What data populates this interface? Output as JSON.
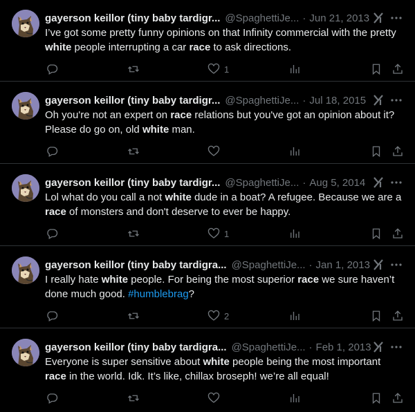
{
  "colors": {
    "background": "#000000",
    "text": "#e7e9ea",
    "muted": "#71767b",
    "hashtag": "#1d9bf0",
    "avatar_bg": "#8a86b8"
  },
  "tweets": [
    {
      "display_name": "gayerson keillor (tiny baby tardigr...",
      "handle": "@SpaghettiJe...",
      "sep": "·",
      "date": "Jun 21, 2013",
      "segments": [
        {
          "t": "I’ve got some pretty funny opinions on that Infinity commercial with the pretty "
        },
        {
          "t": "white",
          "b": true
        },
        {
          "t": " people interrupting a car "
        },
        {
          "t": "race",
          "b": true
        },
        {
          "t": " to ask directions."
        }
      ],
      "likes": "1"
    },
    {
      "display_name": "gayerson keillor (tiny baby tardigr...",
      "handle": "@SpaghettiJe...",
      "sep": "·",
      "date": "Jul 18, 2015",
      "segments": [
        {
          "t": "Oh you're not an expert on "
        },
        {
          "t": "race",
          "b": true
        },
        {
          "t": " relations but you've got an opinion about it? Please do go on, old "
        },
        {
          "t": "white",
          "b": true
        },
        {
          "t": " man."
        }
      ],
      "likes": ""
    },
    {
      "display_name": "gayerson keillor (tiny baby tardigr...",
      "handle": "@SpaghettiJe...",
      "sep": "·",
      "date": "Aug 5, 2014",
      "segments": [
        {
          "t": "Lol what do you call a not "
        },
        {
          "t": "white",
          "b": true
        },
        {
          "t": " dude in a boat? A refugee. Because we are a "
        },
        {
          "t": "race",
          "b": true
        },
        {
          "t": " of monsters and don't deserve to ever be happy."
        }
      ],
      "likes": "1"
    },
    {
      "display_name": "gayerson keillor (tiny baby tardigra...",
      "handle": "@SpaghettiJe...",
      "sep": "·",
      "date": "Jan 1, 2013",
      "segments": [
        {
          "t": "I really hate "
        },
        {
          "t": "white",
          "b": true
        },
        {
          "t": " people. For being the most superior "
        },
        {
          "t": "race",
          "b": true
        },
        {
          "t": " we sure haven’t done much good. "
        },
        {
          "t": "#humblebrag",
          "tag": true
        },
        {
          "t": "?"
        }
      ],
      "likes": "2"
    },
    {
      "display_name": "gayerson keillor (tiny baby tardigra...",
      "handle": "@SpaghettiJe...",
      "sep": "·",
      "date": "Feb 1, 2013",
      "segments": [
        {
          "t": "Everyone is super sensitive about "
        },
        {
          "t": "white",
          "b": true
        },
        {
          "t": " people being the most important "
        },
        {
          "t": "race",
          "b": true
        },
        {
          "t": " in the world. Idk. It’s like, chillax broseph! we’re all equal!"
        }
      ],
      "likes": ""
    }
  ],
  "icons": {
    "avatar": "cat-avatar-icon",
    "grok": "grok-icon",
    "more": "more-icon",
    "reply": "reply-icon",
    "retweet": "retweet-icon",
    "like": "heart-icon",
    "views": "views-icon",
    "bookmark": "bookmark-icon",
    "share": "share-icon"
  }
}
